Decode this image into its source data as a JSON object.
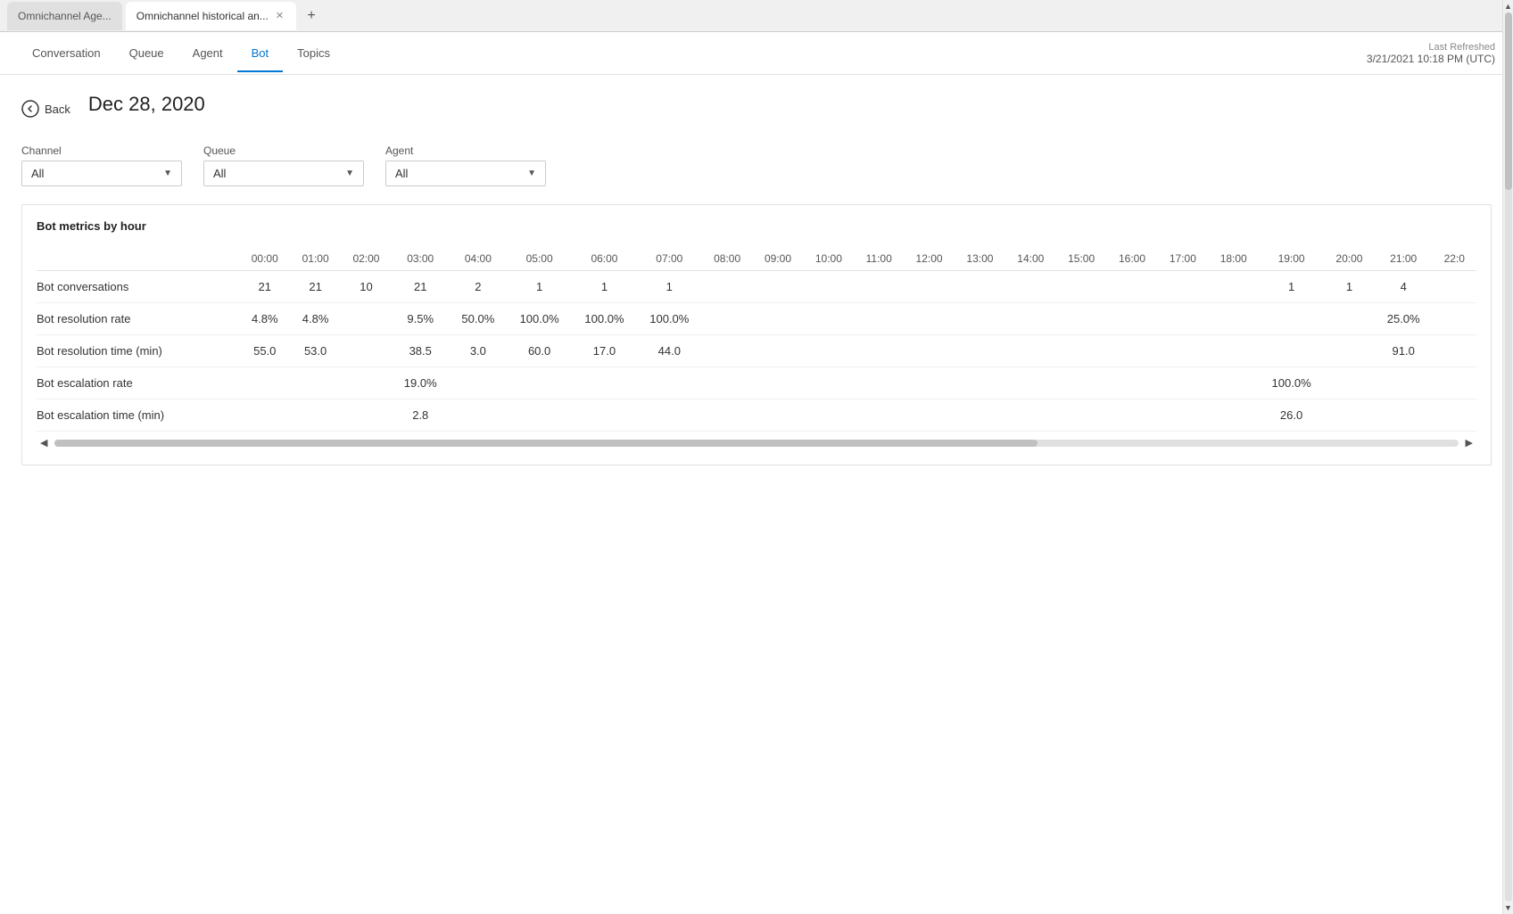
{
  "browser": {
    "tabs": [
      {
        "id": "tab1",
        "label": "Omnichannel Age...",
        "active": false
      },
      {
        "id": "tab2",
        "label": "Omnichannel historical an...",
        "active": true
      }
    ],
    "new_tab_icon": "+"
  },
  "nav": {
    "tabs": [
      {
        "id": "conversation",
        "label": "Conversation",
        "active": false
      },
      {
        "id": "queue",
        "label": "Queue",
        "active": false
      },
      {
        "id": "agent",
        "label": "Agent",
        "active": false
      },
      {
        "id": "bot",
        "label": "Bot",
        "active": true
      },
      {
        "id": "topics",
        "label": "Topics",
        "active": false
      }
    ],
    "last_refreshed_label": "Last Refreshed",
    "last_refreshed_value": "3/21/2021 10:18 PM (UTC)"
  },
  "page": {
    "back_label": "Back",
    "date": "Dec 28, 2020"
  },
  "filters": {
    "channel": {
      "label": "Channel",
      "value": "All"
    },
    "queue": {
      "label": "Queue",
      "value": "All"
    },
    "agent": {
      "label": "Agent",
      "value": "All"
    }
  },
  "metrics_table": {
    "title": "Bot metrics by hour",
    "hours": [
      "00:00",
      "01:00",
      "02:00",
      "03:00",
      "04:00",
      "05:00",
      "06:00",
      "07:00",
      "08:00",
      "09:00",
      "10:00",
      "11:00",
      "12:00",
      "13:00",
      "14:00",
      "15:00",
      "16:00",
      "17:00",
      "18:00",
      "19:00",
      "20:00",
      "21:00",
      "22:0"
    ],
    "rows": [
      {
        "label": "Bot conversations",
        "values": [
          "21",
          "21",
          "10",
          "21",
          "2",
          "1",
          "1",
          "1",
          "",
          "",
          "",
          "",
          "",
          "",
          "",
          "",
          "",
          "",
          "",
          "1",
          "1",
          "4",
          ""
        ]
      },
      {
        "label": "Bot resolution rate",
        "values": [
          "4.8%",
          "4.8%",
          "",
          "9.5%",
          "50.0%",
          "100.0%",
          "100.0%",
          "100.0%",
          "",
          "",
          "",
          "",
          "",
          "",
          "",
          "",
          "",
          "",
          "",
          "",
          "",
          "25.0%",
          ""
        ]
      },
      {
        "label": "Bot resolution time (min)",
        "values": [
          "55.0",
          "53.0",
          "",
          "38.5",
          "3.0",
          "60.0",
          "17.0",
          "44.0",
          "",
          "",
          "",
          "",
          "",
          "",
          "",
          "",
          "",
          "",
          "",
          "",
          "",
          "91.0",
          ""
        ]
      },
      {
        "label": "Bot escalation rate",
        "values": [
          "",
          "",
          "",
          "19.0%",
          "",
          "",
          "",
          "",
          "",
          "",
          "",
          "",
          "",
          "",
          "",
          "",
          "",
          "",
          "",
          "100.0%",
          "",
          "",
          ""
        ]
      },
      {
        "label": "Bot escalation time (min)",
        "values": [
          "",
          "",
          "",
          "2.8",
          "",
          "",
          "",
          "",
          "",
          "",
          "",
          "",
          "",
          "",
          "",
          "",
          "",
          "",
          "",
          "26.0",
          "",
          "",
          ""
        ]
      }
    ]
  }
}
